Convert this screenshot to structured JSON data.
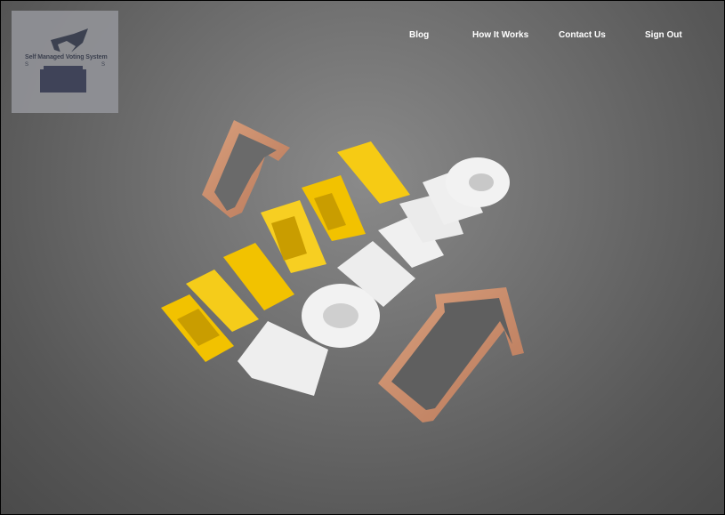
{
  "logo": {
    "text": "Self Managed Voting System",
    "initial_left": "S",
    "initial_right": "S"
  },
  "nav": {
    "blog": "Blog",
    "how_it_works": "How It  Works",
    "contact_us": "Contact Us",
    "sign_out": "Sign Out"
  },
  "colors": {
    "nav_text": "#ffffff",
    "background": "#6f6f6f",
    "accent_yellow": "#f2c200",
    "accent_white": "#eeeeee",
    "arrow_copper": "#c98c6a"
  }
}
